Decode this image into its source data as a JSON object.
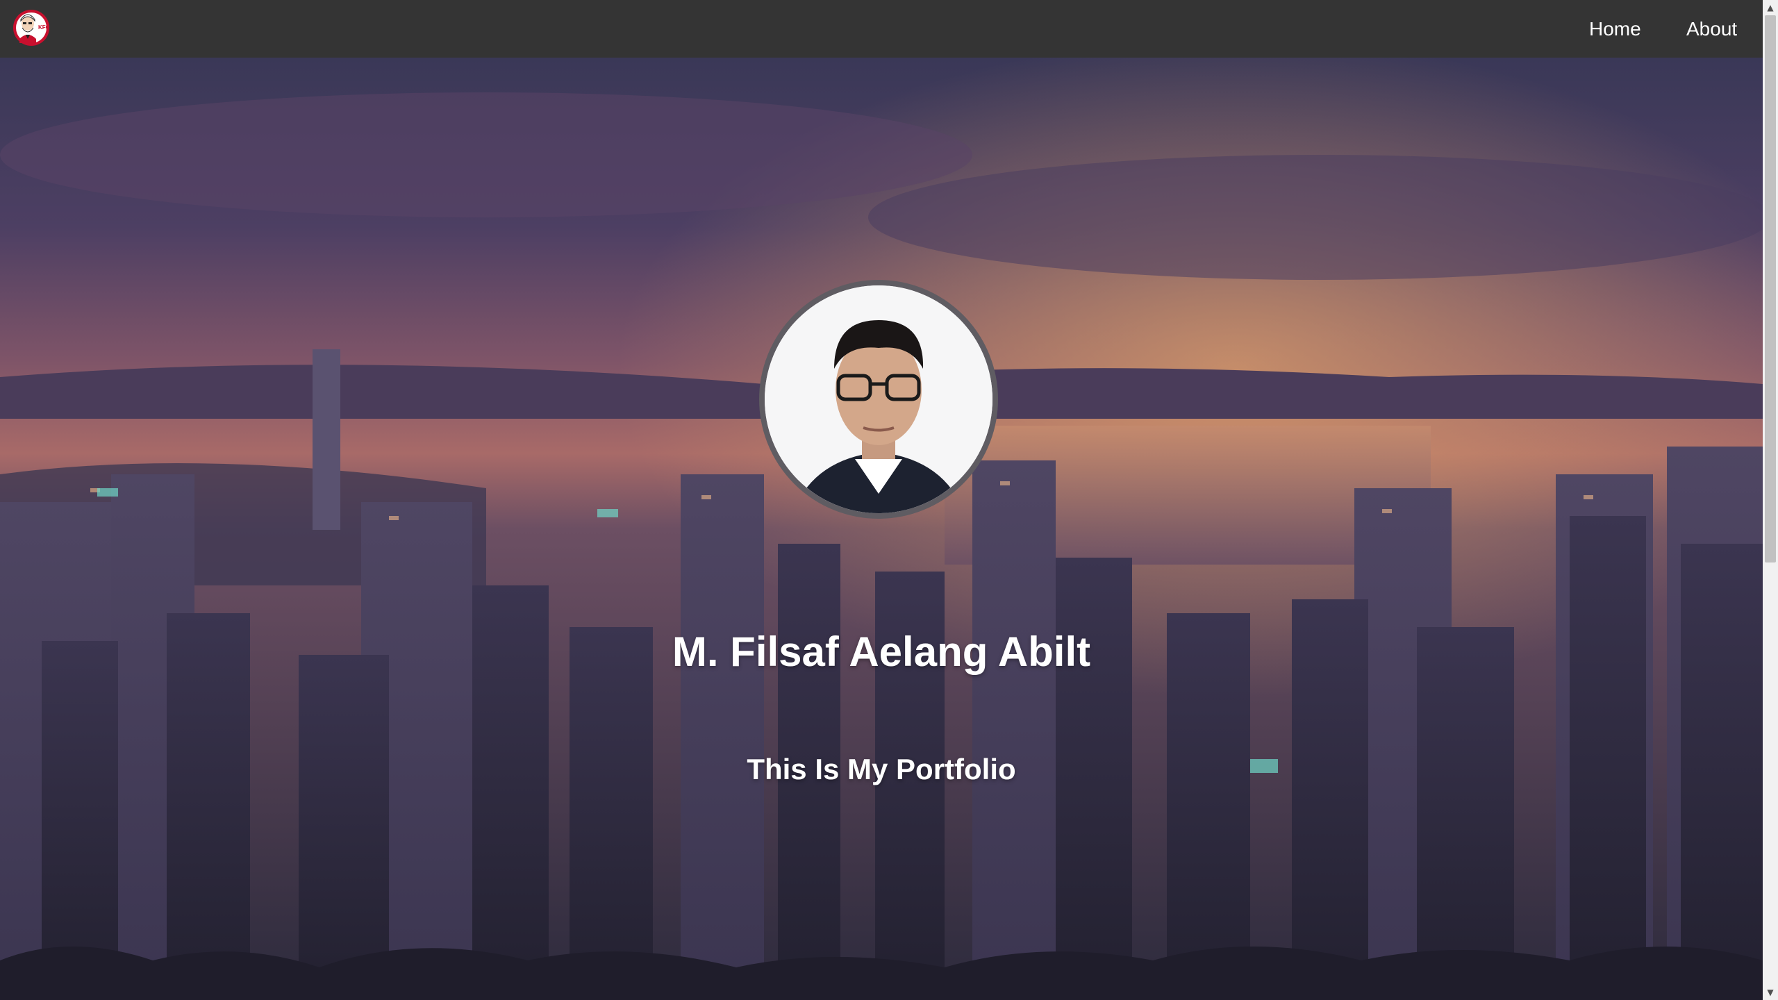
{
  "navbar": {
    "logo_icon": "kfc-colonel-logo",
    "links": [
      {
        "label": "Home"
      },
      {
        "label": "About"
      }
    ]
  },
  "hero": {
    "name": "M. Filsaf Aelang Abilt",
    "tagline": "This Is My Portfolio",
    "background": "city-skyline-at-dusk",
    "avatar": "profile-photo"
  },
  "colors": {
    "navbar_bg": "#343434",
    "text": "#ffffff",
    "avatar_border": "#5f5c62"
  }
}
